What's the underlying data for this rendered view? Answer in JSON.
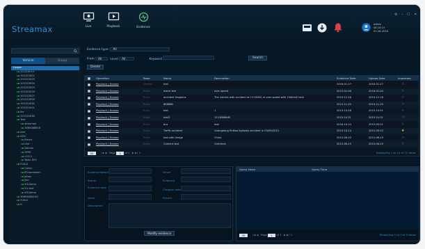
{
  "app": {
    "brand": "Streamax"
  },
  "nav": [
    {
      "label": "Live",
      "icon": "monitor-icon"
    },
    {
      "label": "Playback",
      "icon": "playback-icon"
    },
    {
      "label": "Evidence",
      "icon": "evidence-icon"
    }
  ],
  "user": {
    "name": "admin",
    "time": "08:16:15",
    "date": "01-28-2016"
  },
  "window_controls": "⚙ – ☐ ✕",
  "sidebar": {
    "tabs": [
      "Vehicle",
      "Group"
    ],
    "tree": [
      {
        "label": "Center",
        "depth": 0,
        "selected": true
      },
      {
        "label": "201308101",
        "depth": 1
      },
      {
        "label": "201310021",
        "depth": 1
      },
      {
        "label": "201310023",
        "depth": 1
      },
      {
        "label": "201310024",
        "depth": 1
      },
      {
        "label": "201310025",
        "depth": 1
      },
      {
        "label": "201310026",
        "depth": 1
      },
      {
        "label": "201310027",
        "depth": 1
      },
      {
        "label": "201310028",
        "depth": 1
      },
      {
        "label": "201310030",
        "depth": 1
      },
      {
        "label": "201310031",
        "depth": 1
      },
      {
        "label": "fer",
        "depth": 1
      },
      {
        "label": "201310036",
        "depth": 1
      },
      {
        "label": "Test",
        "depth": 1
      },
      {
        "label": "streamax",
        "depth": 2
      },
      {
        "label": "3060088618",
        "depth": 2
      },
      {
        "label": "test",
        "depth": 1
      },
      {
        "label": "tE5C",
        "depth": 1
      },
      {
        "label": "Bricks",
        "depth": 2
      },
      {
        "label": "Uhd",
        "depth": 2
      },
      {
        "label": "Demon",
        "depth": 2
      },
      {
        "label": "9999",
        "depth": 2
      },
      {
        "label": "c1111",
        "depth": 2
      },
      {
        "label": "Yaxin 003",
        "depth": 2
      },
      {
        "label": "FLN12",
        "depth": 1
      },
      {
        "label": "Calvin",
        "depth": 2
      },
      {
        "label": "IPCoomboxin",
        "depth": 2
      },
      {
        "label": "Jahon",
        "depth": 2
      },
      {
        "label": "Jian",
        "depth": 2
      },
      {
        "label": "X3-Demo",
        "depth": 2
      },
      {
        "label": "D1 test",
        "depth": 2
      },
      {
        "label": "X3-Demo",
        "depth": 2
      },
      {
        "label": "3060A06A130",
        "depth": 1
      },
      {
        "label": "FLN12",
        "depth": 1
      },
      {
        "label": "R",
        "depth": 1
      }
    ]
  },
  "filters": {
    "evidence_type_label": "Evidence type:",
    "evidence_type_value": "All",
    "from_label": "From",
    "from_value": "All",
    "level_label": "Level",
    "level_value": "All",
    "keyword_label": "Keyword",
    "keyword_value": "",
    "search_label": "Search",
    "delete_label": "Delete"
  },
  "grid": {
    "columns": [
      "Operation",
      "Read",
      "Name",
      "Description",
      "Evidence Date",
      "Upload Date",
      "Important"
    ],
    "rows": [
      {
        "op": "Playback | Browse",
        "read": "Unread",
        "name": "test",
        "desc": "",
        "ev": "2016-01-27",
        "up": "2016-01-27",
        "star": false
      },
      {
        "op": "Playback | Browse",
        "read": "Read",
        "name": "alarm test",
        "desc": "over speed",
        "ev": "2015-02-08",
        "up": "2016-01-04",
        "star": false
      },
      {
        "op": "Playback | Browse",
        "read": "Read",
        "name": "Accident Happens",
        "desc": "The vehicle with accident at 11:00AM, in over speed with 150Km/H dd4",
        "ev": "2015-12-18",
        "up": "2015-12-18",
        "star": false
      },
      {
        "op": "Playback | Browse",
        "read": "Read",
        "name": "888888",
        "desc": "",
        "ev": "2015-11-25",
        "up": "2015-11-25",
        "star": false
      },
      {
        "op": "Playback | Browse",
        "read": "Read",
        "name": "test",
        "desc": "1",
        "ev": "2015-10-28",
        "up": "2015-10-31",
        "star": false
      },
      {
        "op": "Playback | Browse",
        "read": "Read",
        "name": "test3",
        "desc": "123-8888AM",
        "ev": "2015-10-31",
        "up": "2015-10-31",
        "star": false
      },
      {
        "op": "Playback | Browse",
        "read": "Read",
        "name": "bus",
        "desc": "test",
        "ev": "2016-10-14",
        "up": "2015-09-21",
        "star": false
      },
      {
        "op": "Playback | Browse",
        "read": "Read",
        "name": "Traffic accident",
        "desc": "Guangdong Shiliao highway accident in 03/09/2015",
        "ev": "2015-10-14",
        "up": "2015-09-03",
        "star": true
      },
      {
        "op": "Playback | Browse",
        "read": "Read",
        "name": "test with image",
        "desc": "China",
        "ev": "2015-06-19",
        "up": "2015-06-19",
        "star": false
      },
      {
        "op": "Playback | Browse",
        "read": "Read",
        "name": "Camera test",
        "desc": "Overtime",
        "ev": "2015-06-19",
        "up": "2015-06-19",
        "star": false
      }
    ],
    "pager": {
      "size": "20",
      "page_label": "Page",
      "page": "1",
      "of": "of 1",
      "summary": "Displaying 1 to 21 of 21 items"
    }
  },
  "detail": {
    "fields": [
      "Evidence Name",
      "Driver",
      "Status",
      "Evidence",
      "Evidence date",
      "Creation date",
      "Value",
      "Picture",
      "Description"
    ],
    "modify_label": "Modify evidence"
  },
  "query": {
    "columns": [
      "Query Users",
      "Query Time"
    ],
    "pager": {
      "size": "20",
      "page_label": "Page",
      "page": "1",
      "of": "of 1",
      "summary": "Displaying 0 to 0 of 0 items"
    }
  },
  "colors": {
    "accent": "#2e8fd4",
    "star": "#f0c430",
    "alarm": "#d94242",
    "unread": "#b03a3a"
  }
}
